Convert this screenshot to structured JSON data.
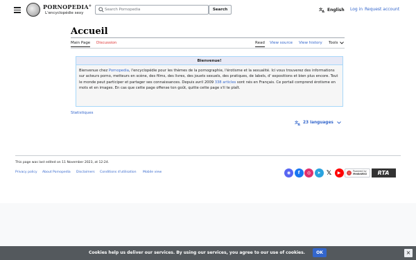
{
  "header": {
    "logo_title": "PORNOPEDIA",
    "logo_reg": "®",
    "logo_subtitle": "L'encyclopédie sexy",
    "search_placeholder": "Search Pornopedia",
    "search_button": "Search",
    "language": "English",
    "login": "Log in",
    "request_account": "Request account"
  },
  "page": {
    "title": "Accueil",
    "tabs": {
      "main_page": "Main Page",
      "discussion": "Discussion",
      "read": "Read",
      "view_source": "View source",
      "view_history": "View history",
      "tools": "Tools"
    }
  },
  "welcome": {
    "heading": "Bienvenue!",
    "intro": "Bienvenue chez ",
    "site_link": "Pornopedia",
    "body1": ", l'encyclopédie pour les thèmes de la pornographie, l'érotisme et la sexualité. Ici vous trouverez des informations sur acteurs porno, metteurs en scène, des films, des livres, des jouets sexuels, des pratiques, de labels, d' expositions et bien plus encore. Tout le monde peut participer et partager ses connaissances. Depuis avril 2009 ",
    "articles_link": "338 articles",
    "body2": " sont nés en Français. Ce portail comprend érotisme en mots et en images. En cas que cette page offense ton goût, quitte cette page s'il te plaît."
  },
  "stats_link": "Statistiques",
  "languages_button": "23 languages",
  "footer": {
    "last_edited": "This page was last edited on 11 November 2023, at 12:24.",
    "links": [
      "Privacy policy",
      "About Pornopedia",
      "Disclaimers",
      "Conditions d'utilisation",
      "Mobile view"
    ],
    "mediawiki_badge": [
      "Powered by",
      "MediaWiki"
    ],
    "rta_label": "RTA"
  },
  "social_icons": [
    {
      "name": "discord-icon",
      "color": "#5865f2",
      "glyph": "◉"
    },
    {
      "name": "facebook-icon",
      "color": "#1877f2",
      "glyph": "f"
    },
    {
      "name": "instagram-icon",
      "color": "#e1306c",
      "glyph": "◎"
    },
    {
      "name": "telegram-icon",
      "color": "#2aa3df",
      "glyph": "➤"
    },
    {
      "name": "x-icon",
      "color": "#ffffff",
      "glyph": "𝕏"
    },
    {
      "name": "youtube-icon",
      "color": "#ff0000",
      "glyph": "▶"
    }
  ],
  "cookie": {
    "text": "Cookies help us deliver our services. By using our services, you agree to our use of cookies.",
    "ok": "OK",
    "close": "×"
  }
}
